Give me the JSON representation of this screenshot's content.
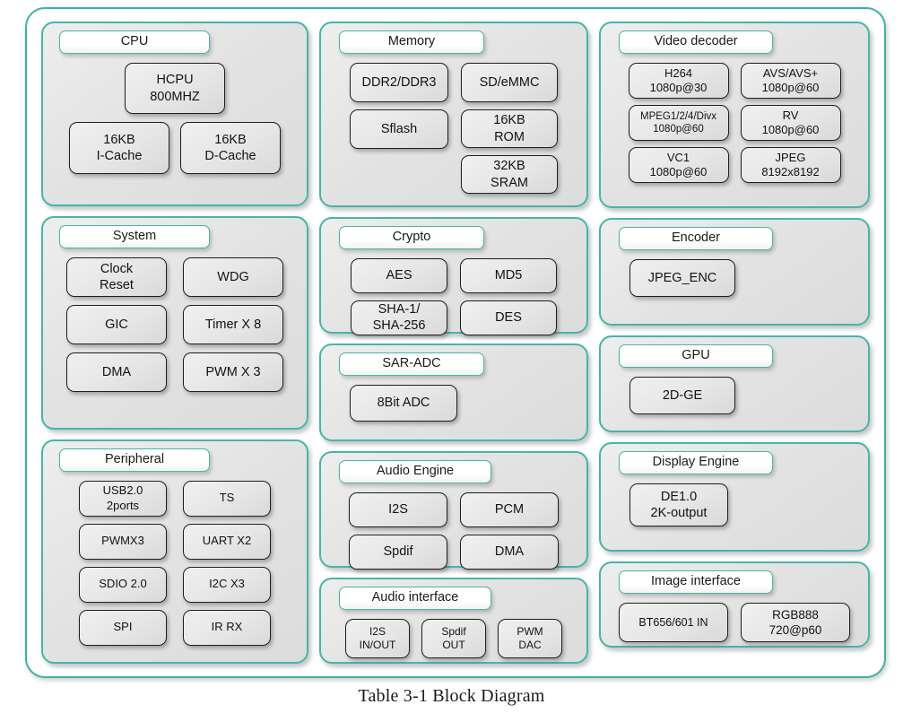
{
  "caption": "Table 3-1 Block Diagram",
  "colors": {
    "frame_border": "#3cb3a4",
    "group_border": "#45b6a8",
    "block_border": "#1f1f1f",
    "group_fill": "#e3e3e3",
    "block_fill": "#e6e6e6",
    "title_fill": "#ffffff",
    "text": "#121212"
  },
  "groups": {
    "cpu": {
      "title": "CPU",
      "blocks": {
        "hcpu": {
          "line1": "HCPU",
          "line2": "800MHZ"
        },
        "icache": {
          "line1": "16KB",
          "line2": "I-Cache"
        },
        "dcache": {
          "line1": "16KB",
          "line2": "D-Cache"
        }
      }
    },
    "system": {
      "title": "System",
      "blocks": [
        {
          "line1": "Clock",
          "line2": "Reset"
        },
        {
          "line1": "WDG",
          "line2": ""
        },
        {
          "line1": "GIC",
          "line2": ""
        },
        {
          "line1": "Timer X 8",
          "line2": ""
        },
        {
          "line1": "DMA",
          "line2": ""
        },
        {
          "line1": "PWM X 3",
          "line2": ""
        }
      ]
    },
    "peripheral": {
      "title": "Peripheral",
      "blocks": [
        {
          "line1": "USB2.0",
          "line2": "2ports"
        },
        {
          "line1": "TS",
          "line2": ""
        },
        {
          "line1": "PWMX3",
          "line2": ""
        },
        {
          "line1": "UART X2",
          "line2": ""
        },
        {
          "line1": "SDIO 2.0",
          "line2": ""
        },
        {
          "line1": "I2C X3",
          "line2": ""
        },
        {
          "line1": "SPI",
          "line2": ""
        },
        {
          "line1": "IR RX",
          "line2": ""
        }
      ]
    },
    "memory": {
      "title": "Memory",
      "blocks": {
        "ddr": {
          "line1": "DDR2/DDR3",
          "line2": ""
        },
        "sflash": {
          "line1": "Sflash",
          "line2": ""
        },
        "sdemmc": {
          "line1": "SD/eMMC",
          "line2": ""
        },
        "rom": {
          "line1": "16KB",
          "line2": "ROM"
        },
        "sram": {
          "line1": "32KB",
          "line2": "SRAM"
        }
      }
    },
    "crypto": {
      "title": "Crypto",
      "blocks": [
        {
          "line1": "AES",
          "line2": ""
        },
        {
          "line1": "MD5",
          "line2": ""
        },
        {
          "line1": "SHA-1/",
          "line2": "SHA-256"
        },
        {
          "line1": "DES",
          "line2": ""
        }
      ]
    },
    "saradc": {
      "title": "SAR-ADC",
      "blocks": {
        "adc": {
          "line1": "8Bit ADC",
          "line2": ""
        }
      }
    },
    "audio_engine": {
      "title": "Audio Engine",
      "blocks": [
        {
          "line1": "I2S",
          "line2": ""
        },
        {
          "line1": "PCM",
          "line2": ""
        },
        {
          "line1": "Spdif",
          "line2": ""
        },
        {
          "line1": "DMA",
          "line2": ""
        }
      ]
    },
    "audio_interface": {
      "title": "Audio interface",
      "blocks": [
        {
          "line1": "I2S",
          "line2": "IN/OUT"
        },
        {
          "line1": "Spdif",
          "line2": "OUT"
        },
        {
          "line1": "PWM",
          "line2": "DAC"
        }
      ]
    },
    "video_decoder": {
      "title": "Video decoder",
      "blocks": [
        {
          "line1": "H264",
          "line2": "1080p@30",
          "small": false
        },
        {
          "line1": "AVS/AVS+",
          "line2": "1080p@60",
          "small": false
        },
        {
          "line1": "MPEG1/2/4/Divx",
          "line2": "1080p@60",
          "small": true
        },
        {
          "line1": "RV",
          "line2": "1080p@60",
          "small": false
        },
        {
          "line1": "VC1",
          "line2": "1080p@60",
          "small": false
        },
        {
          "line1": "JPEG",
          "line2": "8192x8192",
          "small": false
        }
      ]
    },
    "encoder": {
      "title": "Encoder",
      "blocks": {
        "jpeg_enc": {
          "line1": "JPEG_ENC",
          "line2": ""
        }
      }
    },
    "gpu": {
      "title": "GPU",
      "blocks": {
        "ge": {
          "line1": "2D-GE",
          "line2": ""
        }
      }
    },
    "display_engine": {
      "title": "Display Engine",
      "blocks": {
        "de": {
          "line1": "DE1.0",
          "line2": "2K-output"
        }
      }
    },
    "image_interface": {
      "title": "Image interface",
      "blocks": {
        "bt656": {
          "line1": "BT656/601 IN",
          "line2": ""
        },
        "rgb888": {
          "line1": "RGB888",
          "line2": "720@p60"
        }
      }
    }
  }
}
